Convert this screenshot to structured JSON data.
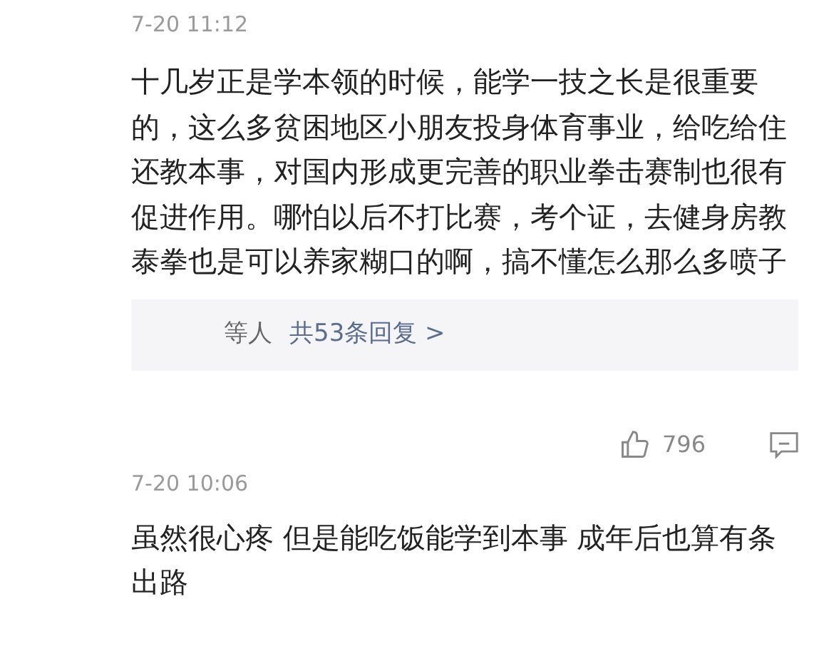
{
  "comments": [
    {
      "time": "7-20 11:12",
      "text": "十几岁正是学本领的时候，能学一技之长是很重要的，这么多贫困地区小朋友投身体育事业，给吃给住还教本事，对国内形成更完善的职业拳击赛制也很有促进作用。哪怕以后不打比赛，考个证，去健身房教泰拳也是可以养家糊口的啊，搞不懂怎么那么多喷子",
      "replies": {
        "users": "等人",
        "link": "共53条回复 >"
      },
      "likes": "796"
    },
    {
      "time": "7-20 10:06",
      "text": "虽然很心疼 但是能吃饭能学到本事 成年后也算有条出路"
    }
  ]
}
